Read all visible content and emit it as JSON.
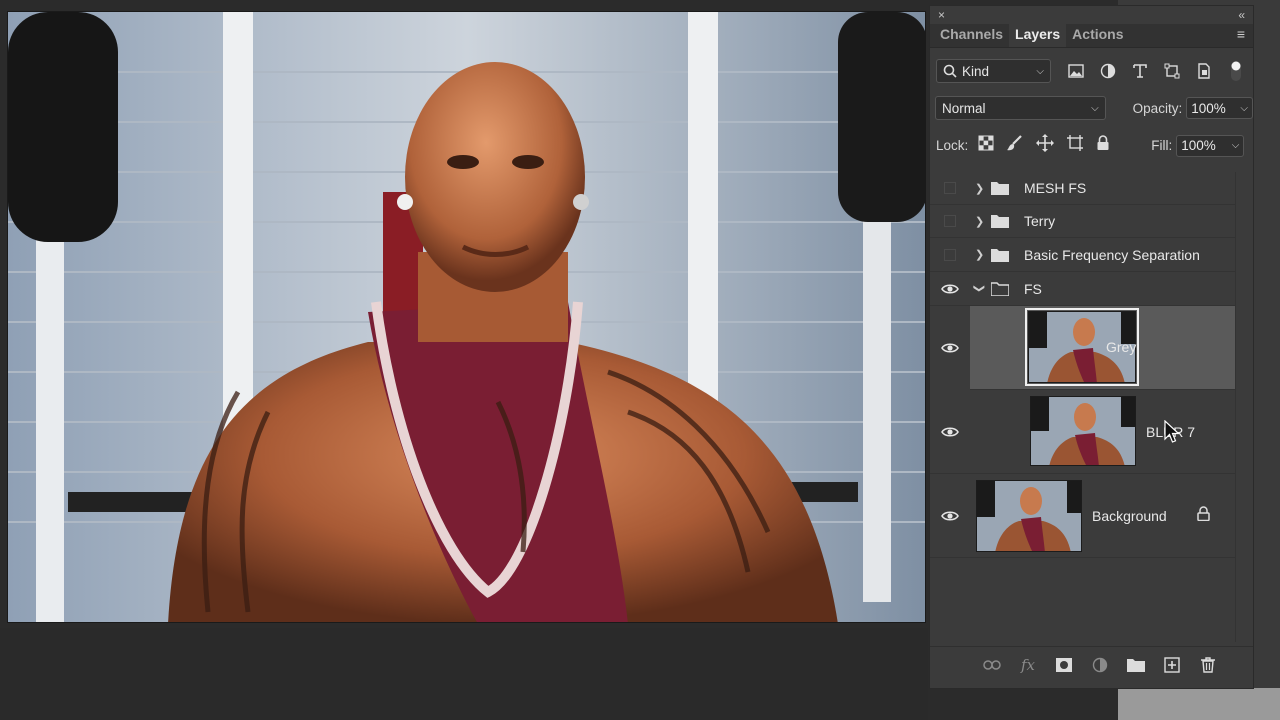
{
  "panel": {
    "tabs": [
      {
        "label": "Channels",
        "active": false
      },
      {
        "label": "Layers",
        "active": true
      },
      {
        "label": "Actions",
        "active": false
      }
    ],
    "close_glyph": "×",
    "collapse_glyph": "«",
    "menu_glyph": "≡"
  },
  "filter": {
    "kind_label": "Kind",
    "icons": [
      "image-filter-icon",
      "adjustment-filter-icon",
      "type-filter-icon",
      "shape-filter-icon",
      "smart-object-filter-icon"
    ]
  },
  "blend": {
    "mode": "Normal",
    "opacity_label": "Opacity:",
    "opacity_value": "100%"
  },
  "lock": {
    "label": "Lock:",
    "fill_label": "Fill:",
    "fill_value": "100%"
  },
  "layers": [
    {
      "name": "MESH FS",
      "type": "group",
      "visible": false,
      "expanded": false
    },
    {
      "name": "Terry",
      "type": "group",
      "visible": false,
      "expanded": false
    },
    {
      "name": "Basic Frequency Separation",
      "type": "group",
      "visible": false,
      "expanded": false
    },
    {
      "name": "FS",
      "type": "group",
      "visible": true,
      "expanded": true
    },
    {
      "name": "Grey",
      "type": "pixel",
      "visible": true,
      "selected": true
    },
    {
      "name": "BLUR 7",
      "type": "pixel",
      "visible": true,
      "selected": false
    },
    {
      "name": "Background",
      "type": "pixel",
      "visible": true,
      "locked": true
    }
  ],
  "footer_icons": [
    "link-layers-icon",
    "fx-icon",
    "layer-mask-icon",
    "adjustment-layer-icon",
    "new-group-icon",
    "new-layer-icon",
    "trash-icon"
  ],
  "footer_fx": "fx",
  "colors": {
    "panel_bg": "#3b3b3b",
    "selected_row": "#5a5a5a",
    "canvas_bg": "#2b2b2b"
  }
}
